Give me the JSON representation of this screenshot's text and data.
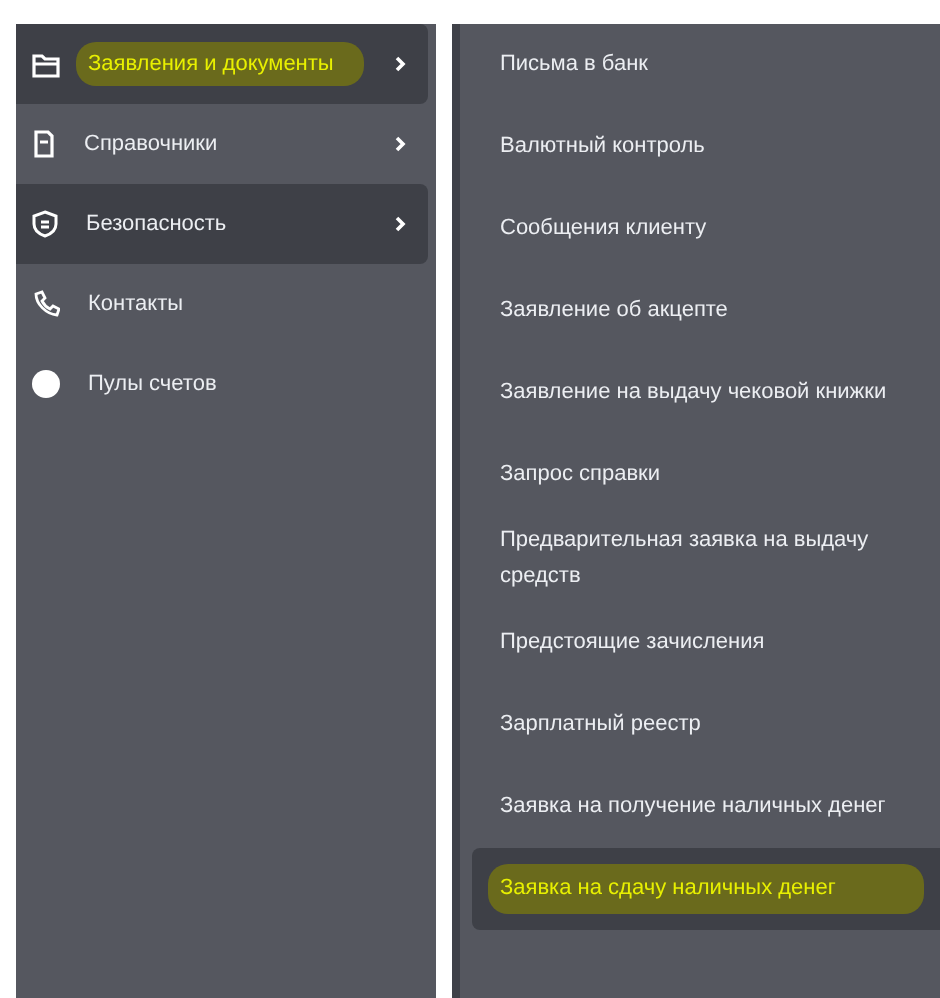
{
  "sidebar": {
    "items": [
      {
        "label": "Заявления и документы",
        "selected": true,
        "marked": true,
        "has_arrow": true
      },
      {
        "label": "Справочники",
        "selected": false,
        "marked": false,
        "has_arrow": true
      },
      {
        "label": "Безопасность",
        "selected": true,
        "marked": false,
        "has_arrow": true
      },
      {
        "label": "Контакты",
        "selected": false,
        "marked": false,
        "has_arrow": false
      },
      {
        "label": "Пулы счетов",
        "selected": false,
        "marked": false,
        "has_arrow": false
      }
    ]
  },
  "submenu": {
    "items": [
      {
        "label": "Письма в банк",
        "selected": false,
        "marked": false
      },
      {
        "label": "Валютный контроль",
        "selected": false,
        "marked": false
      },
      {
        "label": "Сообщения клиенту",
        "selected": false,
        "marked": false
      },
      {
        "label": "Заявление об акцепте",
        "selected": false,
        "marked": false
      },
      {
        "label": "Заявление на выдачу чековой книжки",
        "selected": false,
        "marked": false
      },
      {
        "label": "Запрос справки",
        "selected": false,
        "marked": false
      },
      {
        "label": "Предварительная заявка на выдачу средств",
        "selected": false,
        "marked": false
      },
      {
        "label": "Предстоящие зачисления",
        "selected": false,
        "marked": false
      },
      {
        "label": "Зарплатный реестр",
        "selected": false,
        "marked": false
      },
      {
        "label": "Заявка на получение наличных денег",
        "selected": false,
        "marked": false
      },
      {
        "label": "Заявка на сдачу наличных денег",
        "selected": true,
        "marked": true
      }
    ]
  }
}
